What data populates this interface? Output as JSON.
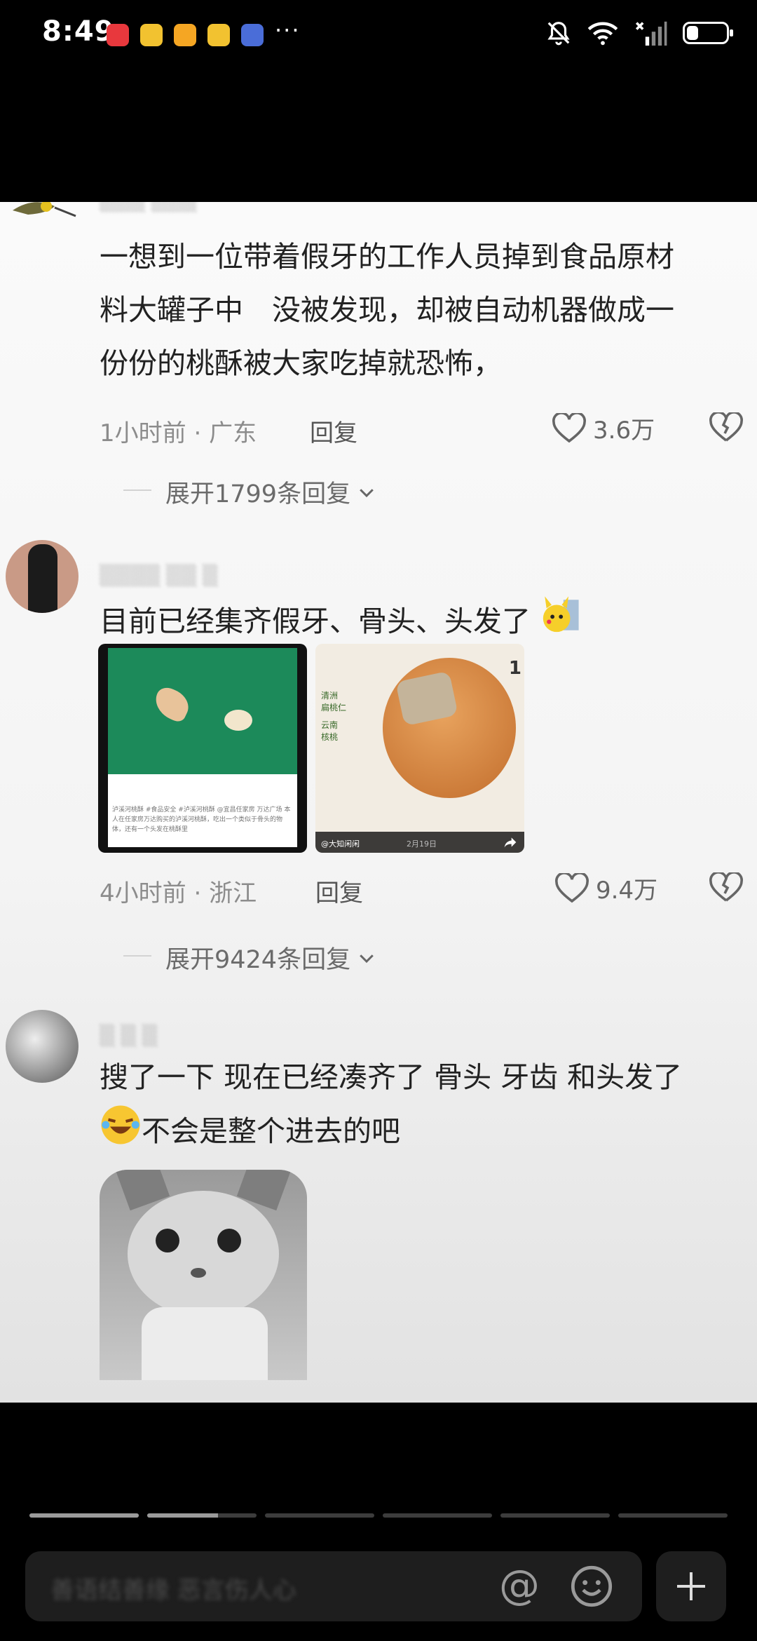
{
  "status_bar": {
    "time": "8:49",
    "more": "···",
    "notification_apps": [
      "huawei-icon",
      "weibo-icon",
      "taobao-icon",
      "weibo-icon",
      "game-icon"
    ],
    "battery_level": 0.3
  },
  "comments": [
    {
      "text_lines": [
        "一想到一位带着假牙的工作人员掉到食品原材",
        "料大罐子中　没被发现，却被自动机器做成一",
        "份份的桃酥被大家吃掉就恐怖，"
      ],
      "time": "1小时前",
      "location": "广东",
      "reply": "回复",
      "likes": "3.6万",
      "expand": "展开1799条回复"
    },
    {
      "text": "目前已经集齐假牙、骨头、头发了",
      "time": "4小时前",
      "location": "浙江",
      "reply": "回复",
      "likes": "9.4万",
      "expand": "展开9424条回复",
      "images": [
        {
          "caption": "泸溪河桃酥 #食品安全 #泸溪河桃酥 @宜昌任家房 万达广场 本人在任家房万达购买的泸溪河桃酥，吃出一个类似于骨头的物体，还有一个头发在桃酥里"
        },
        {
          "labels": [
            "清洲",
            "扁桃仁",
            "云南",
            "核桃"
          ],
          "account": "@大知闲闲",
          "date": "2月19日",
          "badge": "1"
        }
      ]
    },
    {
      "text_line1": "搜了一下 现在已经凑齐了 骨头 牙齿 和头发了",
      "text_line2": "不会是整个进去的吧"
    }
  ],
  "bottom": {
    "placeholder": "善语结善缘 恶言伤人心",
    "progress": [
      1,
      0.65,
      0,
      0,
      0,
      0
    ]
  }
}
